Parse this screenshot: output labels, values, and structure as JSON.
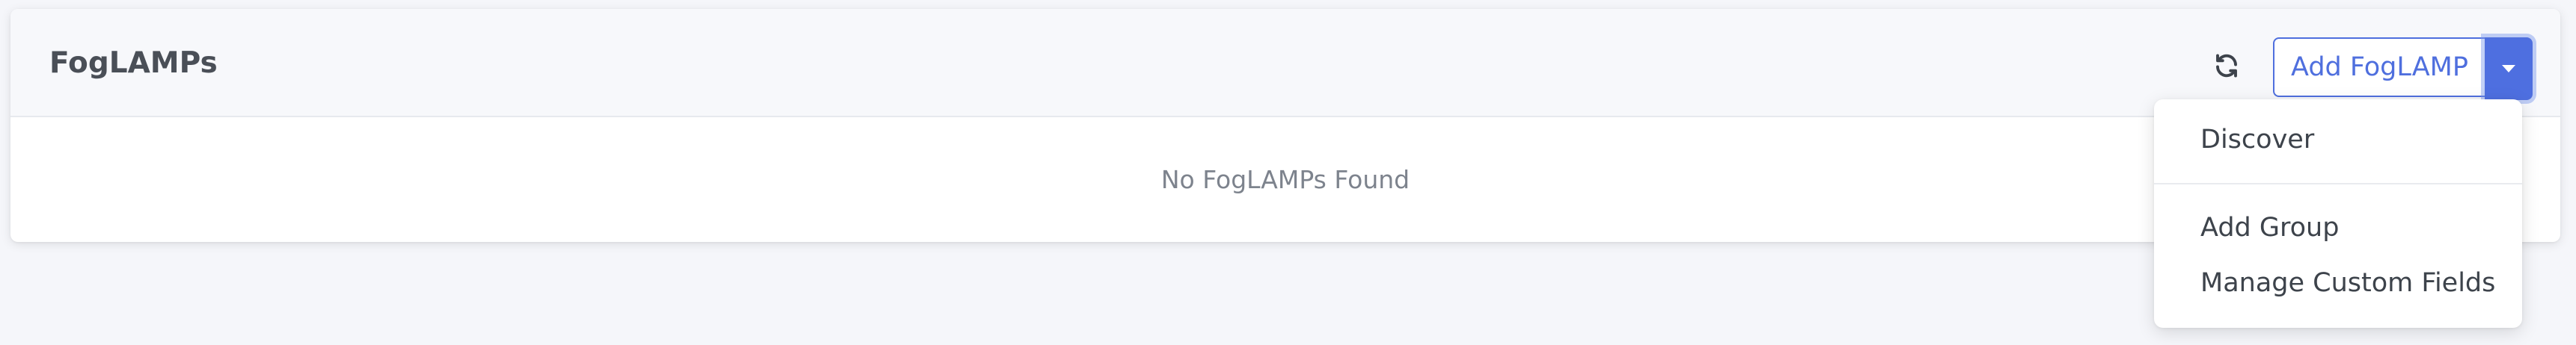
{
  "header": {
    "title": "FogLAMPs",
    "refresh_icon": "refresh-icon",
    "add_button_label": "Add FogLAMP",
    "caret_icon": "caret-down-icon"
  },
  "body": {
    "empty_message": "No FogLAMPs Found"
  },
  "dropdown": {
    "items": [
      {
        "label": "Discover"
      },
      {
        "label": "Add Group"
      },
      {
        "label": "Manage Custom Fields"
      }
    ]
  },
  "colors": {
    "accent": "#4f6fde",
    "page_bg": "#f5f6fa",
    "header_bg": "#f7f8fb",
    "title_text": "#4a4f57",
    "muted_text": "#7d838d"
  }
}
